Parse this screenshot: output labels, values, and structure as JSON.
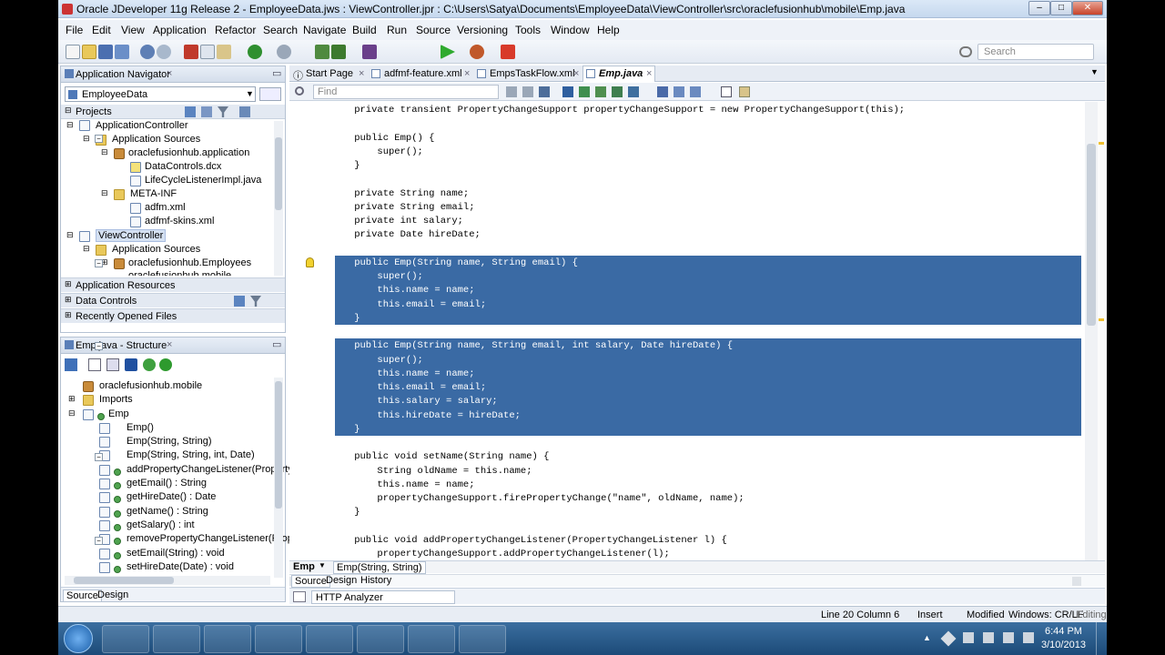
{
  "window": {
    "title": "Oracle JDeveloper 11g Release 2 - EmployeeData.jws : ViewController.jpr : C:\\Users\\Satya\\Documents\\EmployeeData\\ViewController\\src\\oraclefusionhub\\mobile\\Emp.java"
  },
  "menu": [
    "File",
    "Edit",
    "View",
    "Application",
    "Refactor",
    "Search",
    "Navigate",
    "Build",
    "Run",
    "Source",
    "Versioning",
    "Tools",
    "Window",
    "Help"
  ],
  "search": {
    "placeholder": "Search"
  },
  "app_nav": {
    "title": "Application Navigator",
    "app_name": "EmployeeData",
    "projects_label": "Projects",
    "tree": [
      "ApplicationController",
      "Application Sources",
      "oraclefusionhub.application",
      "DataControls.dcx",
      "LifeCycleListenerImpl.java",
      "META-INF",
      "adfm.xml",
      "adfmf-skins.xml",
      "ViewController",
      "Application Sources",
      "oraclefusionhub.Employees",
      "oraclefusionhub.mobile"
    ],
    "sections": [
      "Application Resources",
      "Data Controls",
      "Recently Opened Files"
    ]
  },
  "structure": {
    "title": "Emp.java - Structure",
    "items": [
      "oraclefusionhub.mobile",
      "Imports",
      "Emp",
      "Emp()",
      "Emp(String, String)",
      "Emp(String, String, int, Date)",
      "addPropertyChangeListener(Property",
      "getEmail() : String",
      "getHireDate() : Date",
      "getName() : String",
      "getSalary() : int",
      "removePropertyChangeListener(Prop",
      "setEmail(String) : void",
      "setHireDate(Date) : void"
    ],
    "bottom_tabs": [
      "Source",
      "Design"
    ]
  },
  "editor": {
    "tabs": [
      "Start Page",
      "adfmf-feature.xml",
      "EmpsTaskFlow.xml",
      "Emp.java"
    ],
    "find_placeholder": "Find",
    "lines": [
      "    private transient PropertyChangeSupport propertyChangeSupport = new PropertyChangeSupport(this);",
      "",
      "    public Emp() {",
      "        super();",
      "    }",
      "",
      "    private String name;",
      "    private String email;",
      "    private int salary;",
      "    private Date hireDate;",
      "",
      "    public Emp(String name, String email) {",
      "        super();",
      "        this.name = name;",
      "        this.email = email;",
      "    }",
      "",
      "    public Emp(String name, String email, int salary, Date hireDate) {",
      "        super();",
      "        this.name = name;",
      "        this.email = email;",
      "        this.salary = salary;",
      "        this.hireDate = hireDate;",
      "    }",
      "",
      "    public void setName(String name) {",
      "        String oldName = this.name;",
      "        this.name = name;",
      "        propertyChangeSupport.firePropertyChange(\"name\", oldName, name);",
      "    }",
      "",
      "    public void addPropertyChangeListener(PropertyChangeListener l) {",
      "        propertyChangeSupport.addPropertyChangeListener(l);"
    ],
    "breadcrumb": [
      "Emp",
      "Emp(String, String)"
    ],
    "bottom_tabs": [
      "Source",
      "Design",
      "History"
    ]
  },
  "log": {
    "tab": "HTTP Analyzer"
  },
  "status": {
    "position": "Line 20 Column 6",
    "mode": "Insert",
    "modified": "Modified",
    "line_endings": "Windows: CR/LF",
    "editing": "Editing"
  },
  "taskbar": {
    "time": "6:44 PM",
    "date": "3/10/2013"
  }
}
